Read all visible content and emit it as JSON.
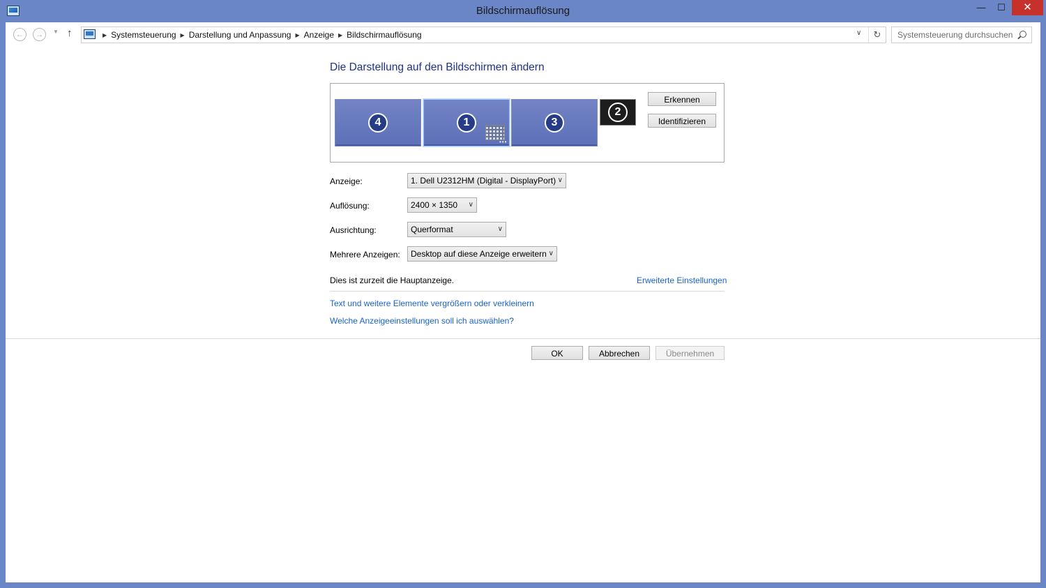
{
  "window": {
    "title": "Bildschirmauflösung",
    "minimize_glyph": "—",
    "maximize_glyph": "☐",
    "close_glyph": "✕"
  },
  "nav": {
    "back_glyph": "←",
    "forward_glyph": "→",
    "recent_glyph": "▼",
    "up_glyph": "↑",
    "breadcrumbs": [
      "Systemsteuerung",
      "Darstellung und Anpassung",
      "Anzeige",
      "Bildschirmauflösung"
    ],
    "separator_glyph": "▶",
    "dropdown_glyph": "∨",
    "refresh_glyph": "↻",
    "search_placeholder": "Systemsteuerung durchsuchen"
  },
  "main": {
    "heading": "Die Darstellung auf den Bildschirmen ändern",
    "monitors": [
      {
        "number": "4",
        "selected": false
      },
      {
        "number": "1",
        "selected": true
      },
      {
        "number": "3",
        "selected": false
      },
      {
        "number": "2",
        "selected": false,
        "inactive": true
      }
    ],
    "detect_label": "Erkennen",
    "identify_label": "Identifizieren",
    "display_label": "Anzeige:",
    "display_value": "1. Dell U2312HM (Digital - DisplayPort)",
    "resolution_label": "Auflösung:",
    "resolution_value": "2400 × 1350",
    "orientation_label": "Ausrichtung:",
    "orientation_value": "Querformat",
    "multi_label": "Mehrere Anzeigen:",
    "multi_value": "Desktop auf diese Anzeige erweitern",
    "primary_status": "Dies ist zurzeit die Hauptanzeige.",
    "advanced_link": "Erweiterte Einstellungen",
    "text_size_link": "Text und weitere Elemente vergrößern oder verkleinern",
    "help_link": "Welche Anzeigeeinstellungen soll ich auswählen?",
    "chevron_glyph": "∨",
    "dots_glyph": "•••"
  },
  "footer": {
    "ok_label": "OK",
    "cancel_label": "Abbrechen",
    "apply_label": "Übernehmen"
  },
  "colors": {
    "frame": "#6b86c7",
    "heading": "#1e3287",
    "link": "#1a62c9",
    "close": "#c7312b"
  }
}
